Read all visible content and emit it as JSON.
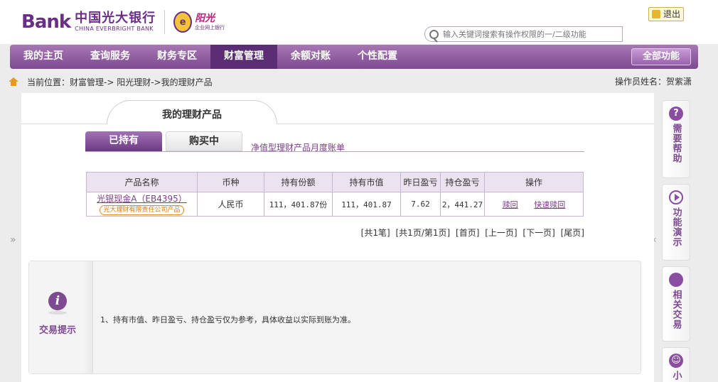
{
  "header": {
    "logo_bank": "Bank",
    "logo_cn": "中国光大银行",
    "logo_en": "CHINA EVERBRIGHT BANK",
    "sunshine_title": "阳光",
    "sunshine_sub": "企业网上银行",
    "logout_label": "退出",
    "search_placeholder": "输入关键词搜索有操作权限的一/二级功能"
  },
  "nav": {
    "items": [
      {
        "label": "我的主页"
      },
      {
        "label": "查询服务"
      },
      {
        "label": "财务专区"
      },
      {
        "label": "财富管理"
      },
      {
        "label": "余额对账"
      },
      {
        "label": "个性配置"
      }
    ],
    "active_index": 3,
    "all_functions": "全部功能"
  },
  "breadcrumb": {
    "prefix": "当前位置：",
    "path": "财富管理->  阳光理财->我的理财产品"
  },
  "operator": "操作员姓名：贺紫潇",
  "page_title": "我的理财产品",
  "tabs": [
    {
      "label": "已持有",
      "active": true
    },
    {
      "label": "购买中",
      "active": false
    }
  ],
  "monthly_link": "净值型理财产品月度账单",
  "table": {
    "headers": [
      "产品名称",
      "币种",
      "持有份额",
      "持有市值",
      "昨日盈亏",
      "持仓盈亏",
      "操作"
    ],
    "rows": [
      {
        "product_name": "光银现金A（EB4395）",
        "product_tag": "光大理财有限责任公司产品",
        "currency": "人民币",
        "shares": "111，401.87份",
        "market_value": "111，401.87",
        "yesterday_pl": "7.62",
        "position_pl": "2，441.27",
        "action_redeem": "赎回",
        "action_fast_redeem": "快速赎回"
      }
    ]
  },
  "pager": {
    "total": "[共1笔]",
    "pages": "[共1页/第1页]",
    "first": "[首页]",
    "prev": "[上一页]",
    "next": "[下一页]",
    "last": "[尾页]"
  },
  "tips": {
    "title": "交易提示",
    "text": "1、持有市值、昨日盈亏、持仓盈亏仅为参考，具体收益以实际到账为准。"
  },
  "side_panel": {
    "help": "需要帮助",
    "demo": "功能演示",
    "related": "相关交易",
    "small": "小"
  },
  "arrows": {
    "left": "»",
    "right": "«"
  },
  "colors": {
    "brand_purple": "#7e4a92",
    "nav_active": "#5b2d74",
    "accent_orange": "#e89a1d"
  }
}
